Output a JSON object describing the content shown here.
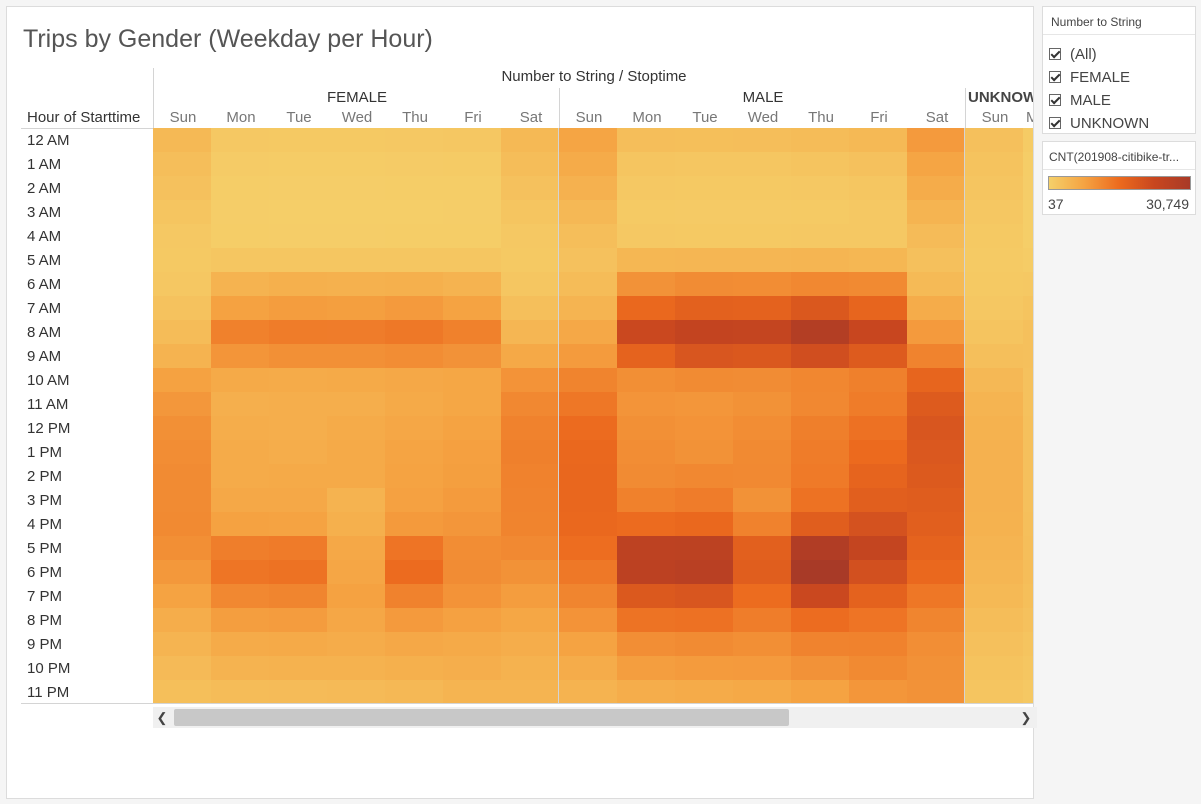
{
  "title": "Trips by Gender (Weekday per Hour)",
  "column_header": "Number to String  /  Stoptime",
  "row_header": "Hour of Starttime",
  "filter": {
    "title": "Number to String",
    "items": [
      {
        "label": "(All)",
        "checked": true
      },
      {
        "label": "FEMALE",
        "checked": true
      },
      {
        "label": "MALE",
        "checked": true
      },
      {
        "label": "UNKNOWN",
        "checked": true
      }
    ]
  },
  "legend": {
    "title": "CNT(201908-citibike-tr...",
    "min_label": "37",
    "max_label": "30,749",
    "colors": [
      "#f5d06a",
      "#f5a342",
      "#ec6a1e",
      "#c8461f",
      "#a83a27"
    ]
  },
  "scroll": {
    "left_icon": "chevron-left-icon",
    "right_icon": "chevron-right-icon"
  },
  "chart_data": {
    "type": "heatmap",
    "title": "Trips by Gender (Weekday per Hour)",
    "column_header": "Number to String / Stoptime",
    "row_header": "Hour of Starttime",
    "groups": [
      "FEMALE",
      "MALE",
      "UNKNOWN"
    ],
    "days": [
      "Sun",
      "Mon",
      "Tue",
      "Wed",
      "Thu",
      "Fri",
      "Sat"
    ],
    "visible_day_labels": {
      "FEMALE": [
        "Sun",
        "Mon",
        "Tue",
        "Wed",
        "Thu",
        "Fri",
        "Sat"
      ],
      "MALE": [
        "Sun",
        "Mon",
        "Tue",
        "Wed",
        "Thu",
        "Fri",
        "Sat"
      ],
      "UNKNOWN": [
        "Sun",
        "M"
      ]
    },
    "group_labels": [
      "FEMALE",
      "MALE",
      "UNKNOW"
    ],
    "hours": [
      "12 AM",
      "1 AM",
      "2 AM",
      "3 AM",
      "4 AM",
      "5 AM",
      "6 AM",
      "7 AM",
      "8 AM",
      "9 AM",
      "10 AM",
      "11 AM",
      "12 PM",
      "1 PM",
      "2 PM",
      "3 PM",
      "4 PM",
      "5 PM",
      "6 PM",
      "7 PM",
      "8 PM",
      "9 PM",
      "10 PM",
      "11 PM"
    ],
    "color_range": [
      37,
      30749
    ],
    "values": {
      "FEMALE": [
        [
          2400,
          700,
          600,
          600,
          700,
          800,
          2400
        ],
        [
          1800,
          350,
          300,
          300,
          350,
          400,
          1900
        ],
        [
          1400,
          250,
          200,
          200,
          250,
          250,
          1400
        ],
        [
          1000,
          200,
          150,
          150,
          180,
          200,
          1000
        ],
        [
          700,
          250,
          200,
          200,
          220,
          250,
          700
        ],
        [
          600,
          900,
          900,
          900,
          900,
          900,
          600
        ],
        [
          800,
          3200,
          3600,
          3500,
          3600,
          3200,
          900
        ],
        [
          1300,
          5600,
          6200,
          6000,
          6500,
          5500,
          1600
        ],
        [
          2000,
          9800,
          10500,
          10400,
          11000,
          9800,
          2800
        ],
        [
          3200,
          7200,
          7800,
          7800,
          8200,
          7500,
          4600
        ],
        [
          5600,
          4400,
          4300,
          4400,
          4700,
          4900,
          7400
        ],
        [
          6900,
          3700,
          3800,
          3900,
          4400,
          4900,
          8800
        ],
        [
          7800,
          4000,
          3900,
          4300,
          4800,
          5400,
          9600
        ],
        [
          8200,
          4300,
          4000,
          4500,
          5300,
          5800,
          9900
        ],
        [
          8400,
          4300,
          4400,
          4400,
          5400,
          6000,
          9700
        ],
        [
          8400,
          4700,
          4700,
          3200,
          5700,
          6400,
          9500
        ],
        [
          8600,
          5600,
          5500,
          3600,
          6600,
          7000,
          9400
        ],
        [
          8000,
          10200,
          10600,
          4700,
          11500,
          8200,
          8700
        ],
        [
          6800,
          11400,
          11800,
          5000,
          12800,
          8300,
          7600
        ],
        [
          5400,
          8800,
          9200,
          5600,
          9600,
          7400,
          6200
        ],
        [
          4000,
          6100,
          6300,
          4800,
          6500,
          5700,
          4900
        ],
        [
          3000,
          4300,
          4500,
          4100,
          4700,
          4500,
          4000
        ],
        [
          2200,
          3200,
          3300,
          3300,
          3600,
          3900,
          3300
        ],
        [
          1700,
          2000,
          2100,
          2200,
          2500,
          3000,
          3000
        ]
      ],
      "MALE": [
        [
          5200,
          1800,
          1700,
          1800,
          2000,
          2400,
          6500
        ],
        [
          4300,
          1000,
          900,
          900,
          1100,
          1400,
          5200
        ],
        [
          3400,
          700,
          600,
          600,
          700,
          900,
          4100
        ],
        [
          2500,
          500,
          450,
          450,
          500,
          700,
          3000
        ],
        [
          1800,
          700,
          600,
          600,
          650,
          700,
          2100
        ],
        [
          1400,
          2700,
          2800,
          2800,
          2900,
          2700,
          1500
        ],
        [
          2000,
          7500,
          8300,
          8200,
          8800,
          8600,
          2300
        ],
        [
          3100,
          13500,
          15000,
          14700,
          17000,
          14000,
          4200
        ],
        [
          4700,
          21000,
          23000,
          22500,
          27500,
          21500,
          6500
        ],
        [
          6400,
          14500,
          17500,
          17000,
          19500,
          16500,
          9500
        ],
        [
          9400,
          8000,
          8500,
          8300,
          9000,
          9900,
          14000
        ],
        [
          11200,
          7300,
          7000,
          7600,
          8900,
          10500,
          16500
        ],
        [
          12800,
          7800,
          7400,
          8200,
          10000,
          11900,
          17500
        ],
        [
          13500,
          8200,
          7600,
          8600,
          10500,
          13000,
          17200
        ],
        [
          13600,
          8500,
          8900,
          8700,
          10700,
          14200,
          16600
        ],
        [
          13600,
          9800,
          10400,
          7600,
          11800,
          15500,
          16000
        ],
        [
          13500,
          12800,
          13400,
          9600,
          15800,
          18500,
          15500
        ],
        [
          12500,
          24500,
          24800,
          15200,
          28000,
          22500,
          14500
        ],
        [
          11000,
          25000,
          25800,
          15800,
          30749,
          19000,
          13500
        ],
        [
          9200,
          16800,
          17500,
          12700,
          21000,
          14800,
          11200
        ],
        [
          7400,
          11700,
          11900,
          10300,
          12600,
          11500,
          9300
        ],
        [
          5500,
          8100,
          8500,
          8000,
          9500,
          9700,
          8100
        ],
        [
          4200,
          6100,
          6400,
          6500,
          7500,
          8600,
          7700
        ],
        [
          3200,
          4000,
          4300,
          4600,
          5400,
          7000,
          7500
        ]
      ],
      "UNKNOWN": [
        [
          1500,
          400
        ],
        [
          1200,
          250
        ],
        [
          1000,
          200
        ],
        [
          800,
          150
        ],
        [
          600,
          150
        ],
        [
          500,
          300
        ],
        [
          600,
          700
        ],
        [
          800,
          1100
        ],
        [
          1100,
          1500
        ],
        [
          1600,
          1500
        ],
        [
          2500,
          1400
        ],
        [
          3100,
          1400
        ],
        [
          3300,
          1500
        ],
        [
          3400,
          1500
        ],
        [
          3400,
          1500
        ],
        [
          3400,
          1500
        ],
        [
          3300,
          1600
        ],
        [
          3100,
          1800
        ],
        [
          2800,
          1900
        ],
        [
          2400,
          1700
        ],
        [
          1900,
          1400
        ],
        [
          1500,
          1100
        ],
        [
          1200,
          900
        ],
        [
          1000,
          700
        ]
      ]
    }
  }
}
